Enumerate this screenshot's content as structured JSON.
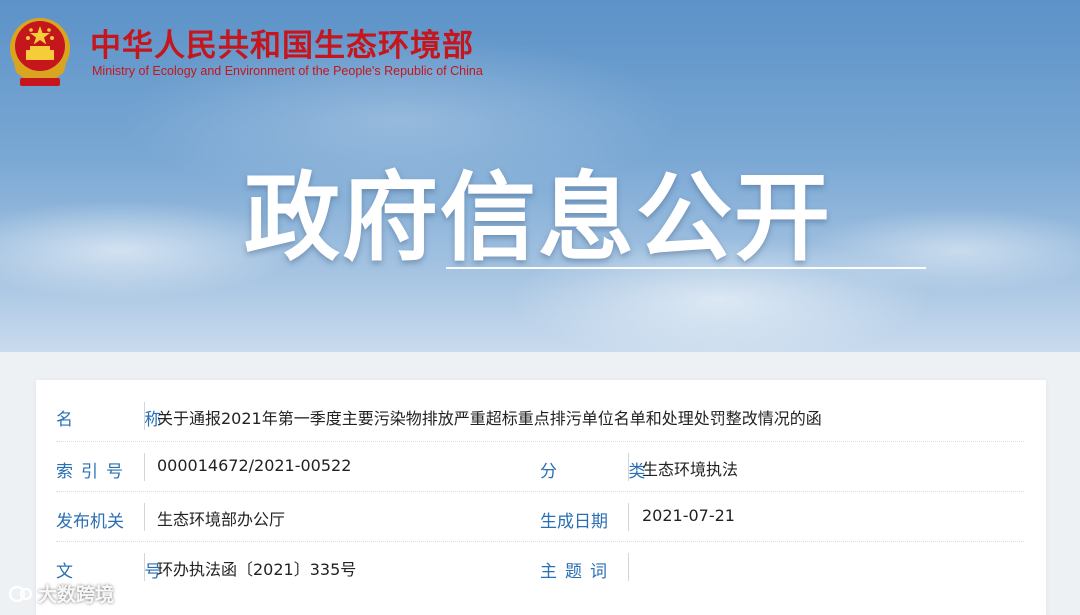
{
  "header": {
    "ministry_cn": "中华人民共和国生态环境部",
    "ministry_en": "Ministry of Ecology and Environment of the People's Republic of China",
    "banner_title": "政府信息公开",
    "emblem_icon": "national-emblem-icon"
  },
  "info": {
    "name_label": "名 称",
    "name_value": "关于通报2021年第一季度主要污染物排放严重超标重点排污单位名单和处理处罚整改情况的函",
    "index_label": "索引号",
    "index_value": "000014672/2021-00522",
    "category_label": "分 类",
    "category_value": "生态环境执法",
    "publisher_label": "发布机关",
    "publisher_value": "生态环境部办公厅",
    "date_label": "生成日期",
    "date_value": "2021-07-21",
    "doc_no_label": "文 号",
    "doc_no_value": "环办执法函〔2021〕335号",
    "keywords_label": "主题词",
    "keywords_value": ""
  },
  "watermark": {
    "text": "大数跨境",
    "icon": "brand-logo-icon"
  },
  "colors": {
    "brand_red": "#c4161c",
    "label_blue": "#2a6fb5"
  }
}
